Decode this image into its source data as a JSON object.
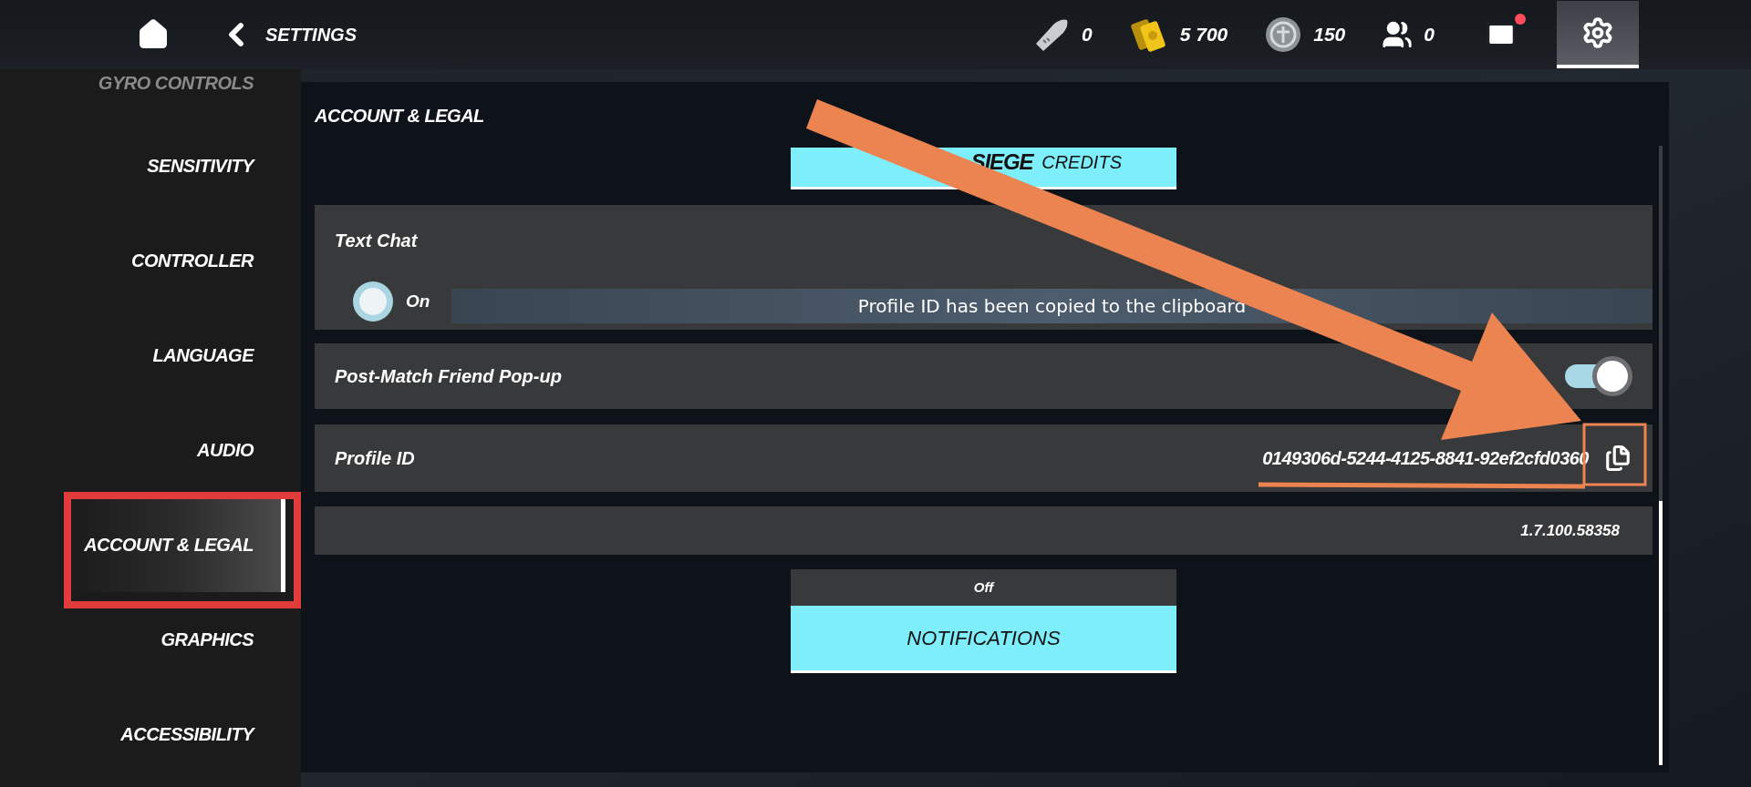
{
  "top_bar": {
    "title": "SETTINGS",
    "currencies": [
      {
        "kind": "ammo",
        "value": "0"
      },
      {
        "kind": "credits",
        "value": "5 700"
      },
      {
        "kind": "renown",
        "value": "150"
      },
      {
        "kind": "friends",
        "value": "0"
      }
    ],
    "mail": {
      "unread": true
    },
    "settings_tab": {
      "selected": true
    }
  },
  "sidebar": {
    "items": [
      {
        "label": "GYRO CONTROLS",
        "selected": false
      },
      {
        "label": "SENSITIVITY",
        "selected": false
      },
      {
        "label": "CONTROLLER",
        "selected": false
      },
      {
        "label": "LANGUAGE",
        "selected": false
      },
      {
        "label": "AUDIO",
        "selected": false
      },
      {
        "label": "ACCOUNT & LEGAL",
        "selected": true
      },
      {
        "label": "GRAPHICS",
        "selected": false
      },
      {
        "label": "ACCESSIBILITY",
        "selected": false
      }
    ]
  },
  "panel": {
    "title": "ACCOUNT & LEGAL",
    "credits_button": {
      "logo": "SIEGE",
      "label": "CREDITS"
    },
    "rows": [
      {
        "kind": "radio",
        "label": "Text Chat",
        "option": "On",
        "checked": true
      },
      {
        "kind": "toggle",
        "label": "Post-Match Friend Pop-up",
        "on": true
      },
      {
        "kind": "copy",
        "label": "Profile ID",
        "value": "0149306d-5244-4125-8841-92ef2cfd0360"
      },
      {
        "kind": "version",
        "value": "1.7.100.58358"
      }
    ],
    "notification_status": "Off",
    "notifications_button": "NOTIFICATIONS"
  },
  "toast": "Profile ID has been copied to the clipboard"
}
